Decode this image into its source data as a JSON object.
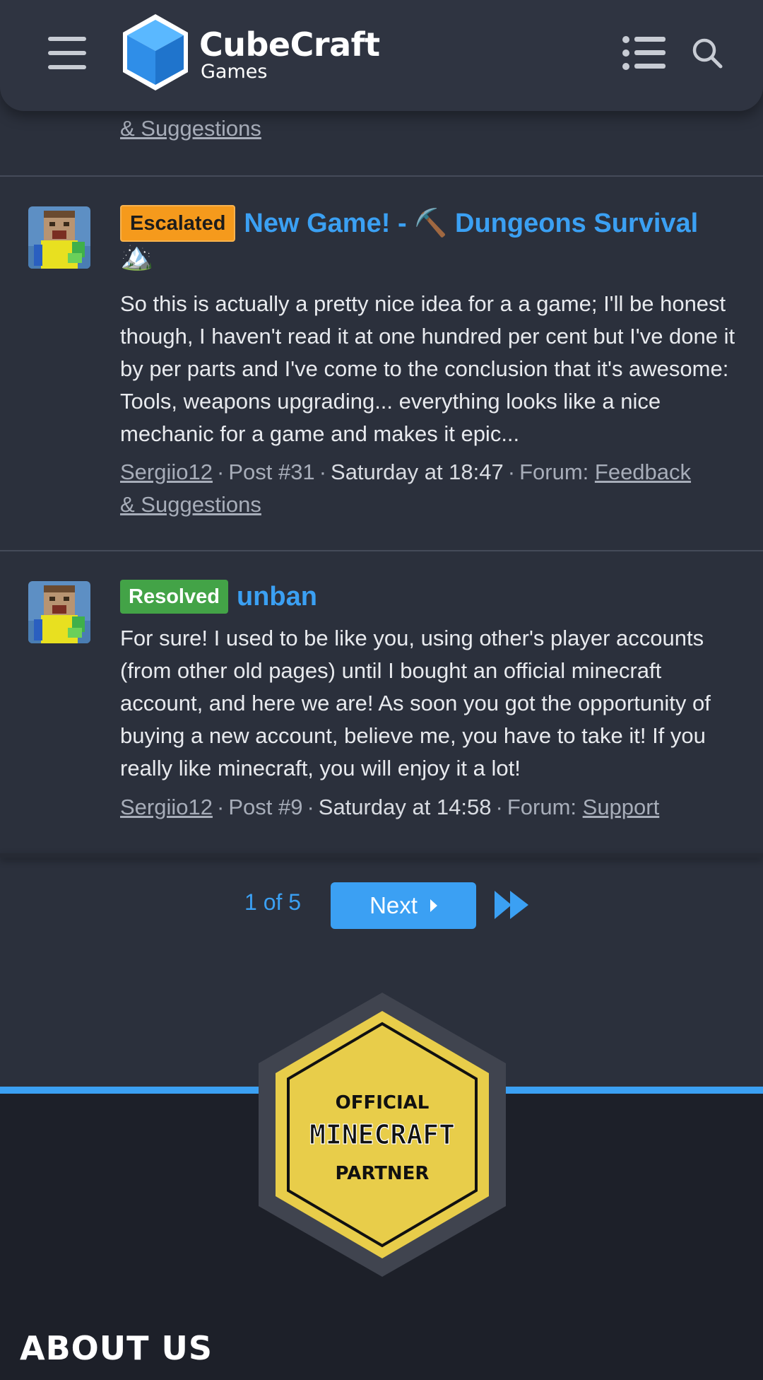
{
  "header": {
    "logo_title": "CubeCraft",
    "logo_sub": "Games"
  },
  "prev_tail": {
    "forum_link": "& Suggestions"
  },
  "posts": [
    {
      "badge": "Escalated",
      "title": "New Game! - ⛏️ Dungeons Survival",
      "title_emoji": "🏔️",
      "snippet": "So this is actually a pretty nice idea for a a game; I'll be honest though, I haven't read it at one hundred per cent but I've done it by per parts and I've come to the conclusion that it's awesome: Tools, weapons upgrading... everything looks like a nice mechanic for a game and makes it epic...",
      "author": "Sergiio12",
      "post_num": "Post #31",
      "time": "Saturday at 18:47",
      "forum_label": "Forum:",
      "forum_line1": "Feedback",
      "forum_line2": "& Suggestions"
    },
    {
      "badge": "Resolved",
      "title": "unban",
      "snippet": "For sure! I used to be like you, using other's player accounts (from other old pages) until I bought an official minecraft account, and here we are! As soon you got the opportunity of buying a new account, believe me, you have to take it! If you really like minecraft, you will enjoy it a lot!",
      "author": "Sergiio12",
      "post_num": "Post #9",
      "time": "Saturday at 14:58",
      "forum_label": "Forum:",
      "forum": "Support"
    }
  ],
  "pagination": {
    "label": "1 of 5",
    "next": "Next"
  },
  "partner_badge": {
    "line1": "OFFICIAL",
    "line2": "MINECRAFT",
    "line3": "PARTNER"
  },
  "footer": {
    "about": "ABOUT US"
  },
  "colors": {
    "accent": "#3ba0f3",
    "escalated": "#f59a1c",
    "resolved": "#43a347",
    "gold": "#e8cd4a"
  }
}
